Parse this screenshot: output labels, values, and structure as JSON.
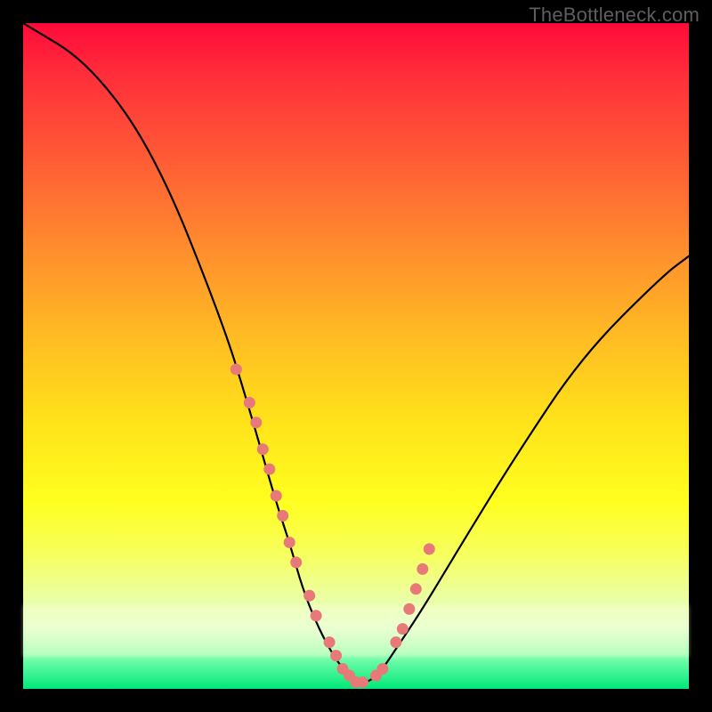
{
  "watermark": "TheBottleneck.com",
  "chart_data": {
    "type": "line",
    "title": "",
    "xlabel": "",
    "ylabel": "",
    "xlim": [
      0,
      100
    ],
    "ylim": [
      0,
      100
    ],
    "x": [
      0,
      10,
      20,
      30,
      34,
      38,
      40,
      42,
      44,
      46,
      48,
      50,
      52,
      54,
      56,
      60,
      66,
      74,
      84,
      96,
      100
    ],
    "values": [
      100,
      94,
      80,
      55,
      42,
      28,
      22,
      15,
      10,
      6,
      3,
      1,
      1,
      3,
      6,
      12,
      22,
      35,
      50,
      62,
      65
    ],
    "markers_x": [
      32,
      34,
      35,
      36,
      37,
      38,
      39,
      40,
      41,
      43,
      44,
      46,
      47,
      48,
      49,
      50,
      51,
      53,
      54,
      56,
      57,
      58,
      59,
      60,
      61
    ],
    "markers_y": [
      48,
      43,
      40,
      36,
      33,
      29,
      26,
      22,
      19,
      14,
      11,
      7,
      5,
      3,
      2,
      1,
      1,
      2,
      3,
      7,
      9,
      12,
      15,
      18,
      21
    ],
    "marker_color": "#e77a78",
    "curve_color": "#000000"
  }
}
